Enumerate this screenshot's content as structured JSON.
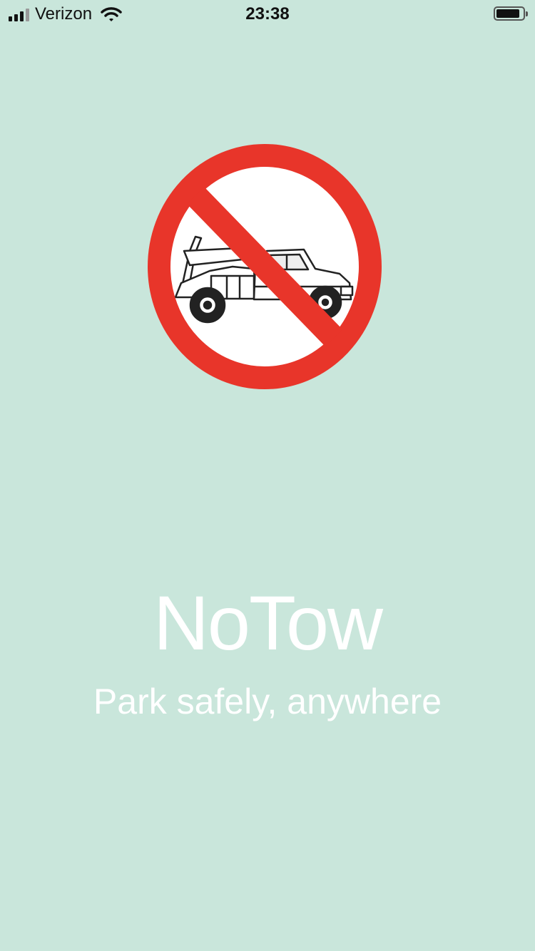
{
  "status_bar": {
    "carrier": "Verizon",
    "time": "23:38",
    "icons": [
      "signal-bars-icon",
      "wifi-icon",
      "battery-icon"
    ]
  },
  "logo": {
    "icon": "no-tow-truck-icon",
    "colors": {
      "ring": "#e8352a",
      "inner": "#ffffff",
      "truck_stroke": "#222222"
    }
  },
  "app": {
    "title": "NoTow",
    "tagline": "Park safely, anywhere"
  },
  "colors": {
    "background": "#c9e6db",
    "text": "#ffffff"
  }
}
